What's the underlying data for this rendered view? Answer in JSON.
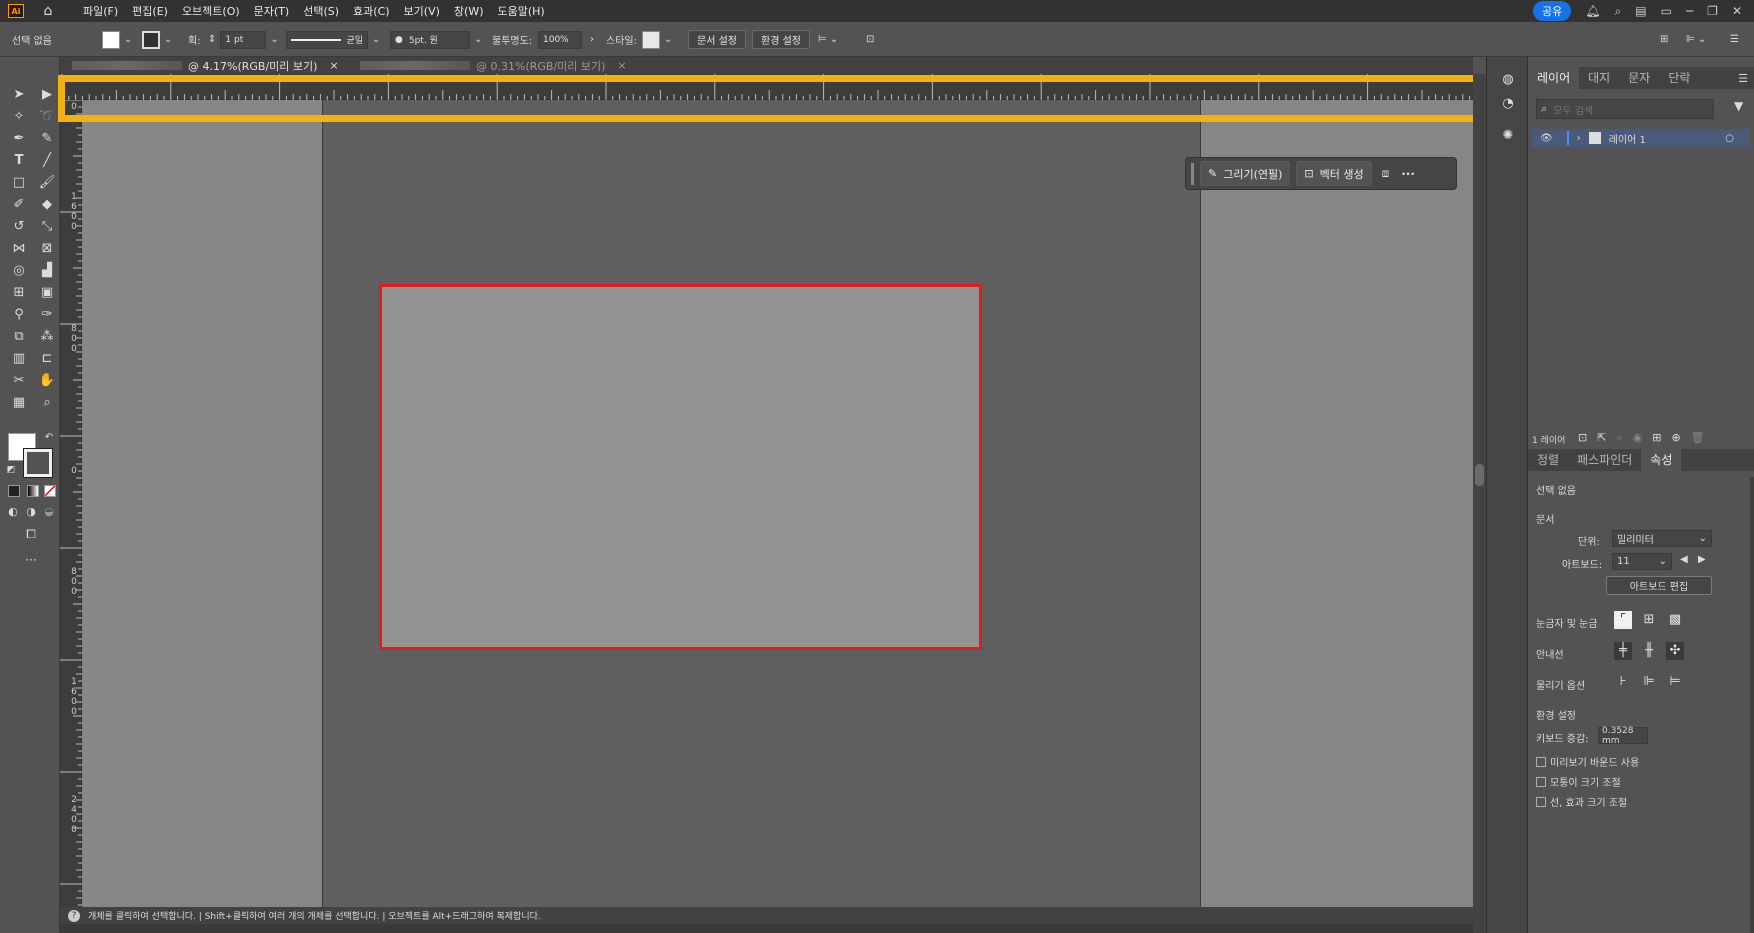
{
  "menubar": {
    "app_logo": "Ai",
    "menus": [
      "파일(F)",
      "편집(E)",
      "오브젝트(O)",
      "문자(T)",
      "선택(S)",
      "효과(C)",
      "보기(V)",
      "창(W)",
      "도움말(H)"
    ],
    "share_label": "공유"
  },
  "controlbar": {
    "selection_label": "선택 없음",
    "stroke_label": "획:",
    "stroke_weight": "1 pt",
    "stroke_style": "균일",
    "brush": "5pt. 원",
    "opacity_label": "불투명도:",
    "opacity_value": "100%",
    "style_label": "스타일:",
    "doc_setup_button": "문서 설정",
    "preferences_button": "환경 설정"
  },
  "tabs": [
    {
      "title": "@ 4.17%(RGB/미리 보기)",
      "close": "×"
    },
    {
      "title": "@ 0.31%(RGB/미리 보기)",
      "close": "×"
    }
  ],
  "ruler_h": {
    "labels": [
      "4000",
      "3200",
      "2400",
      "1600",
      "800",
      "0",
      "800",
      "1600",
      "2400",
      "3200",
      "4000",
      "48"
    ]
  },
  "ruler_v": {
    "labels": [
      [
        "0"
      ],
      [
        "1",
        "6",
        "0",
        "0"
      ],
      [
        "8",
        "0",
        "0"
      ],
      [
        "0"
      ],
      [
        "8",
        "0",
        "0"
      ],
      [
        "1",
        "6",
        "0",
        "0"
      ],
      [
        "2",
        "4",
        "0",
        "0"
      ]
    ]
  },
  "context_bar": {
    "draw_label": "그리기(연필)",
    "vector_label": "벡터 생성",
    "more_label": "···"
  },
  "layers_panel": {
    "tabs": [
      "레이어",
      "대지",
      "문자",
      "단락"
    ],
    "search_placeholder": "모두 검색",
    "layer_name": "레이어 1",
    "footer_count": "1 레이어"
  },
  "properties_panel": {
    "tabs": [
      "정렬",
      "패스파인더",
      "속성"
    ],
    "selection": "선택 없음",
    "document_heading": "문서",
    "units_label": "단위:",
    "units_value": "밀리미터",
    "artboard_label": "아트보드:",
    "artboard_value": "11",
    "edit_artboard_button": "아트보드 편집",
    "rulers_grids_label": "눈금자 및 눈금",
    "guides_label": "안내선",
    "snap_options_label": "물리기 옵션",
    "prefs_heading": "환경 설정",
    "keyboard_increment_label": "키보드 증감:",
    "keyboard_increment_value": "0.3528 mm",
    "checkboxes": [
      "미리보기 바운드 사용",
      "모퉁이 크기 조절",
      "선, 효과 크기 조절"
    ]
  },
  "status": {
    "help_text": "개체를 클릭하여 선택합니다. | Shift+클릭하여 여러 개의 개체를 선택합니다. | 오브젝트를 Alt+드래그하여 복제합니다."
  },
  "colors": {
    "highlight": "#f3b214",
    "artboard_border": "#e31b1b",
    "accent": "#1473e6"
  }
}
